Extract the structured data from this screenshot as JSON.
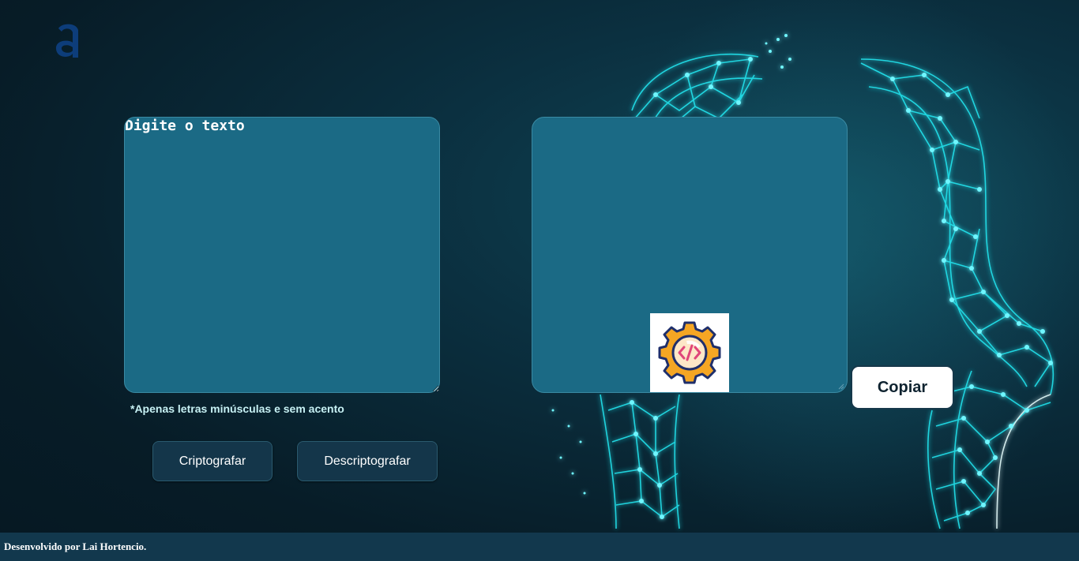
{
  "logo": {
    "icon": "alura-a-logo-icon",
    "color": "#0d3d7a"
  },
  "input": {
    "placeholder": "Digite o texto",
    "value": ""
  },
  "output": {
    "value": "",
    "image_icon": "code-gear-icon"
  },
  "hint": "*Apenas letras minúsculas e sem acento",
  "buttons": {
    "encrypt_label": "Criptografar",
    "decrypt_label": "Descriptografar",
    "copy_label": "Copiar"
  },
  "footer": {
    "text": "Desenvolvido por Lai Hortencio."
  },
  "colors": {
    "background": "#071c27",
    "textarea": "#1b6a85",
    "button": "#14364a",
    "footer": "#12384d",
    "network_glow": "#22e6f0",
    "gear_orange": "#f5a623",
    "gear_outline": "#1f2f6b",
    "code_pink": "#e0467a"
  }
}
